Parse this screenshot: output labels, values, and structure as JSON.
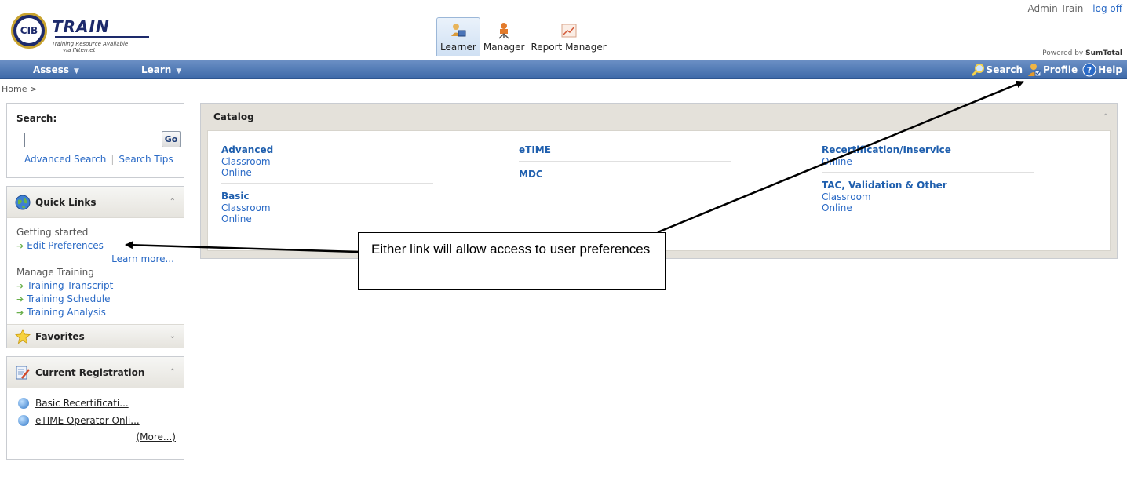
{
  "header": {
    "logo_seal": "CIB",
    "logo_word": "TRAIN",
    "logo_tagline_1": "Training Resource Available",
    "logo_tagline_2": "via INternet",
    "user_name": "Admin Train -",
    "logoff_label": "log off",
    "powered_by": "Powered by",
    "powered_brand": "SumTotal",
    "role_tabs": [
      {
        "label": "Learner",
        "icon": "learner-icon",
        "active": true
      },
      {
        "label": "Manager",
        "icon": "manager-icon",
        "active": false
      },
      {
        "label": "Report Manager",
        "icon": "report-manager-icon",
        "active": false
      }
    ]
  },
  "nav": {
    "menus": [
      {
        "label": "Assess"
      },
      {
        "label": "Learn"
      }
    ],
    "right_links": [
      {
        "label": "Search",
        "icon": "magnifier-icon"
      },
      {
        "label": "Profile",
        "icon": "profile-icon"
      },
      {
        "label": "Help",
        "icon": "help-icon"
      }
    ]
  },
  "breadcrumb": "Home >",
  "search_panel": {
    "label": "Search:",
    "input_value": "",
    "go_label": "Go",
    "advanced_search": "Advanced Search",
    "search_tips": "Search Tips"
  },
  "quick_links": {
    "title": "Quick Links",
    "group_1": "Getting started",
    "edit_preferences": "Edit Preferences",
    "learn_more": "Learn more...",
    "group_2": "Manage Training",
    "items": [
      "Training Transcript",
      "Training Schedule",
      "Training Analysis"
    ],
    "favorites_title": "Favorites"
  },
  "current_registration": {
    "title": "Current Registration",
    "items": [
      "Basic Recertificati...",
      "eTIME Operator Onli..."
    ],
    "more": "(More...)"
  },
  "catalog": {
    "title": "Catalog",
    "columns": [
      [
        {
          "title": "Advanced",
          "subs": [
            "Classroom",
            "Online"
          ]
        },
        {
          "title": "Basic",
          "subs": [
            "Classroom",
            "Online"
          ]
        }
      ],
      [
        {
          "title": "eTIME",
          "subs": []
        },
        {
          "title": "MDC",
          "subs": []
        }
      ],
      [
        {
          "title": "Recertification/Inservice",
          "subs": [
            "Online"
          ]
        },
        {
          "title": "TAC, Validation & Other",
          "subs": [
            "Classroom",
            "Online"
          ]
        }
      ]
    ]
  },
  "callout": {
    "text": "Either link will allow access to user preferences"
  },
  "colors": {
    "nav_bar": "#4f78b5",
    "link": "#2a6ac6",
    "panel_header": "#e6e4de"
  }
}
